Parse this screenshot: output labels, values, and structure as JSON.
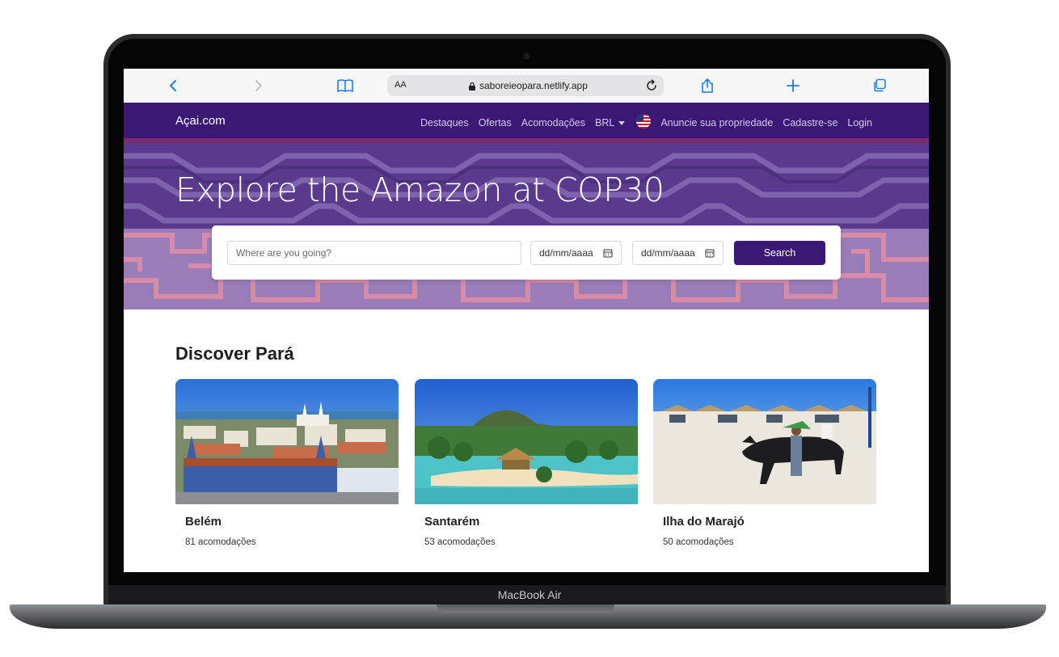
{
  "device": {
    "label": "MacBook Air"
  },
  "browser": {
    "text_size_label": "AA",
    "url": "saboreieopara.netlify.app"
  },
  "navbar": {
    "brand": "Açai.com",
    "links": [
      "Destaques",
      "Ofertas",
      "Acomodações"
    ],
    "currency": "BRL",
    "language_flag": "us-flag-icon",
    "actions": [
      "Anuncie sua propriedade",
      "Cadastre-se",
      "Login"
    ]
  },
  "hero": {
    "title": "Explore the Amazon at COP30",
    "search": {
      "destination_placeholder": "Where are you going?",
      "checkin_placeholder": "dd/mm/aaaa",
      "checkout_placeholder": "dd/mm/aaaa",
      "button_label": "Search"
    }
  },
  "discover": {
    "title": "Discover Pará",
    "cards": [
      {
        "name": "Belém",
        "count": "81 acomodações"
      },
      {
        "name": "Santarém",
        "count": "53 acomodações"
      },
      {
        "name": "Ilha do Marajó",
        "count": "50 acomodações"
      }
    ]
  },
  "colors": {
    "primary": "#3a1874",
    "link": "#1a7cf5",
    "hero_overlay": "#6a4b9c"
  }
}
